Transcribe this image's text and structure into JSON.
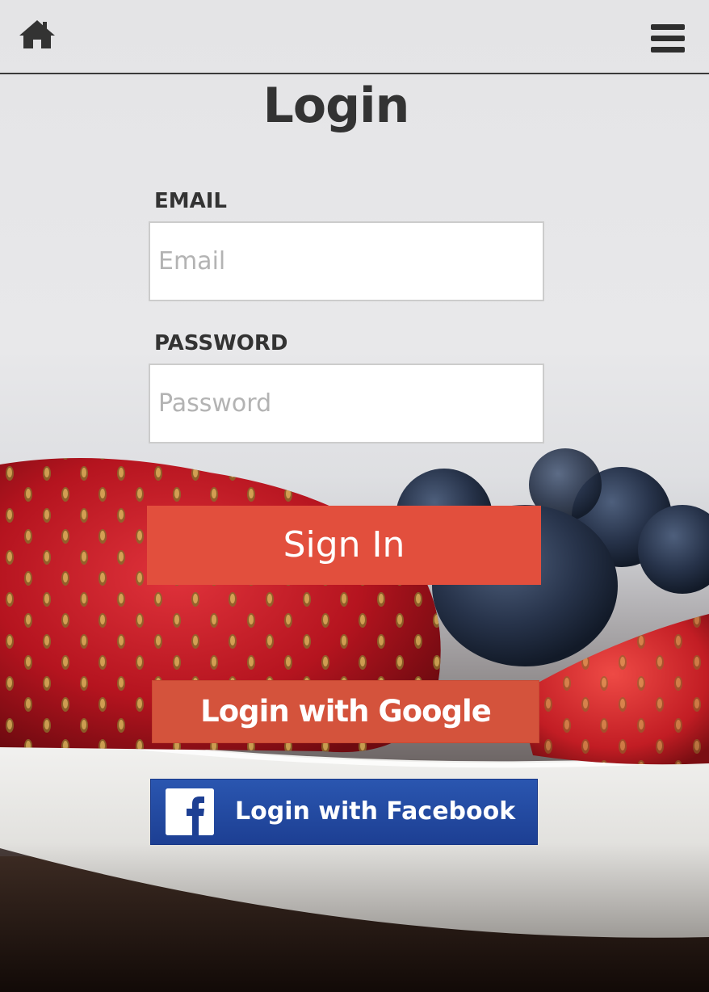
{
  "nav": {
    "home_icon": "home-icon",
    "menu_icon": "hamburger-menu-icon"
  },
  "page": {
    "title": "Login"
  },
  "form": {
    "email_label": "EMAIL",
    "email_placeholder": "Email",
    "email_value": "",
    "password_label": "PASSWORD",
    "password_placeholder": "Password",
    "password_value": "",
    "submit_label": "Sign In"
  },
  "social": {
    "google_label": "Login with Google",
    "facebook_label": "Login with Facebook",
    "facebook_icon": "facebook-logo-icon"
  },
  "colors": {
    "signin_bg": "#e24f3d",
    "google_bg": "#d4533c",
    "facebook_bg": "#1d3f93",
    "text_dark": "#333333"
  }
}
